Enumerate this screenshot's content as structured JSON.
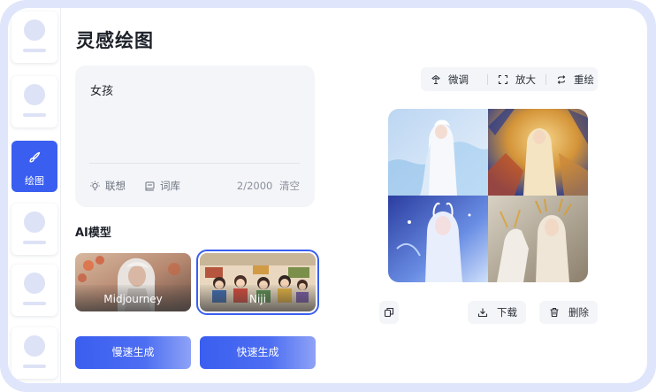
{
  "page": {
    "title": "灵感绘图"
  },
  "sidebar": {
    "active_label": "绘图",
    "accent": "#3a5ef0",
    "placeholder_color": "#dde2f6"
  },
  "prompt": {
    "text": "女孩",
    "tools": [
      {
        "label": "联想",
        "icon": "lightbulb-icon"
      },
      {
        "label": "词库",
        "icon": "library-icon"
      }
    ],
    "counter": "2/2000",
    "clear_label": "清空"
  },
  "models": {
    "section_title": "AI模型",
    "items": [
      {
        "label": "Midjourney",
        "selected": false
      },
      {
        "label": "Niji",
        "selected": true
      }
    ]
  },
  "actions": {
    "slow_generate": "慢速生成",
    "fast_generate": "快速生成"
  },
  "image_toolbar": {
    "items": [
      {
        "label": "微调",
        "icon": "tune-icon"
      },
      {
        "label": "放大",
        "icon": "expand-icon"
      },
      {
        "label": "重绘",
        "icon": "redraw-icon"
      }
    ]
  },
  "image_actions": {
    "copy_icon": "copy-icon",
    "download_label": "下载",
    "delete_label": "删除"
  }
}
